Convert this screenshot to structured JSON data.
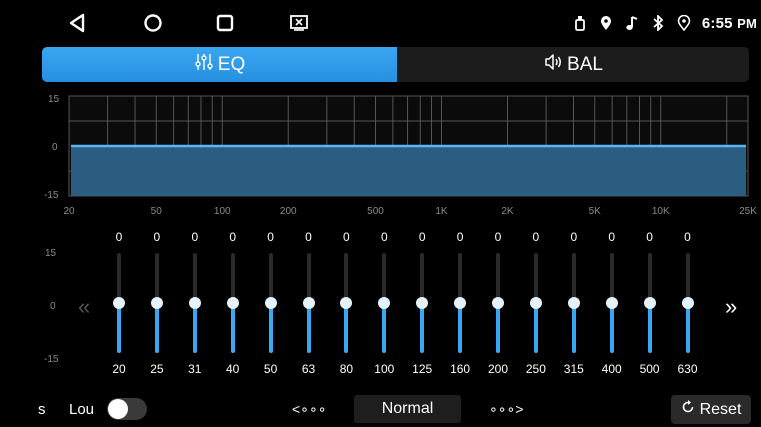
{
  "statusbar": {
    "nav": [
      {
        "name": "back-icon"
      },
      {
        "name": "home-icon"
      },
      {
        "name": "recents-icon"
      },
      {
        "name": "screenshot-icon"
      }
    ],
    "icons": [
      "usb-icon",
      "location-pin-icon",
      "music-note-icon",
      "bluetooth-icon",
      "gps-icon"
    ],
    "time": "6:55",
    "ampm": "PM"
  },
  "tabs": [
    {
      "id": "eq",
      "label": "EQ",
      "icon": "equalizer-sliders-icon",
      "active": true
    },
    {
      "id": "bal",
      "label": "BAL",
      "icon": "speaker-icon",
      "active": false
    }
  ],
  "graph": {
    "y_labels": [
      "15",
      "0",
      "-15"
    ],
    "x_labels": [
      "20",
      "50",
      "100",
      "200",
      "500",
      "1K",
      "2K",
      "5K",
      "10K",
      "25K"
    ],
    "curve_level": 0
  },
  "eq": {
    "scale_labels": [
      "15",
      "0",
      "-15"
    ],
    "range": [
      -15,
      15
    ],
    "bands": [
      {
        "freq": "20",
        "value": "0"
      },
      {
        "freq": "25",
        "value": "0"
      },
      {
        "freq": "31",
        "value": "0"
      },
      {
        "freq": "40",
        "value": "0"
      },
      {
        "freq": "50",
        "value": "0"
      },
      {
        "freq": "63",
        "value": "0"
      },
      {
        "freq": "80",
        "value": "0"
      },
      {
        "freq": "100",
        "value": "0"
      },
      {
        "freq": "125",
        "value": "0"
      },
      {
        "freq": "160",
        "value": "0"
      },
      {
        "freq": "200",
        "value": "0"
      },
      {
        "freq": "250",
        "value": "0"
      },
      {
        "freq": "315",
        "value": "0"
      },
      {
        "freq": "400",
        "value": "0"
      },
      {
        "freq": "500",
        "value": "0"
      },
      {
        "freq": "630",
        "value": "0"
      }
    ],
    "prev_arrow": "«",
    "next_arrow": "»"
  },
  "bottom": {
    "cut_label": "s",
    "loudness_label": "Lou",
    "loudness_on": false,
    "prev_preset": "<∘∘∘",
    "next_preset": "∘∘∘>",
    "preset": "Normal",
    "reset_label": "Reset"
  },
  "colors": {
    "accent": "#3aa7f3",
    "graph_fill": "#2b5d80",
    "background": "#000000"
  }
}
